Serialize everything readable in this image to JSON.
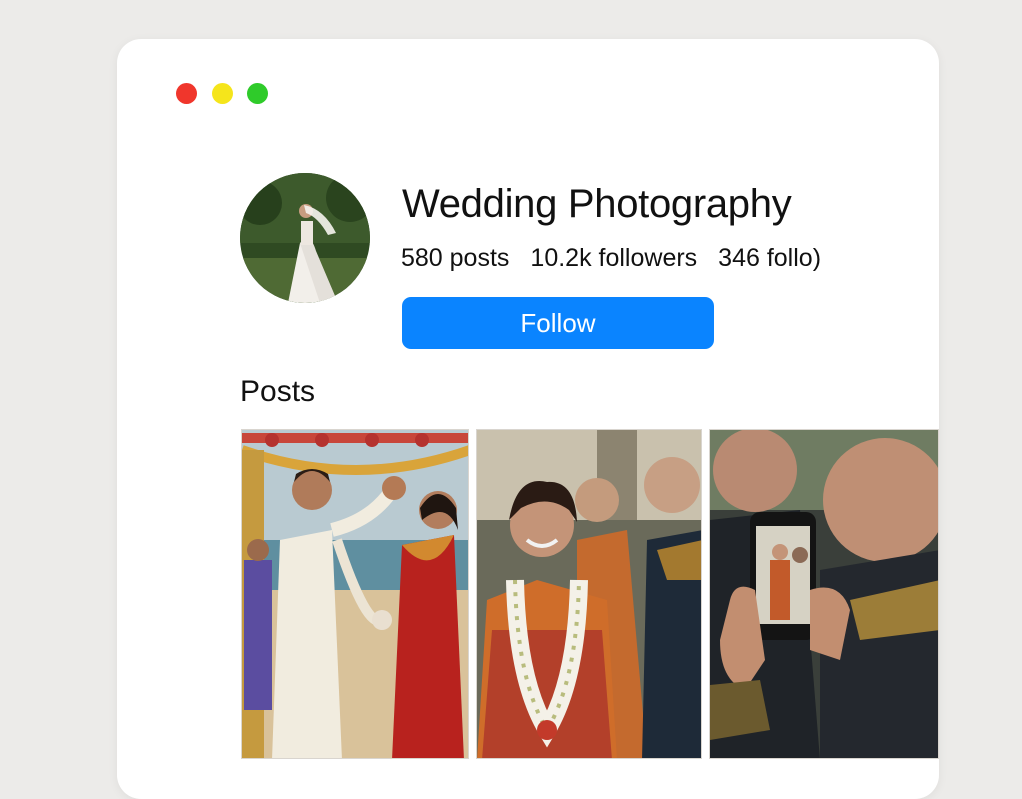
{
  "window": {
    "controls": [
      "close",
      "minimize",
      "maximize"
    ]
  },
  "profile": {
    "name": "Wedding Photography",
    "avatar_icon": "bride-photo",
    "stats": {
      "posts": "580 posts",
      "followers": "10.2k followers",
      "following": "346 follo)"
    },
    "follow_label": "Follow"
  },
  "posts": {
    "title": "Posts",
    "items": [
      {
        "icon": "garland-exchange-photo"
      },
      {
        "icon": "smiling-bride-photo"
      },
      {
        "icon": "guest-phone-photo"
      }
    ]
  },
  "colors": {
    "accent": "#0a84ff",
    "close": "#f0362c",
    "minimize": "#f5e51b",
    "maximize": "#2fcb2a"
  }
}
